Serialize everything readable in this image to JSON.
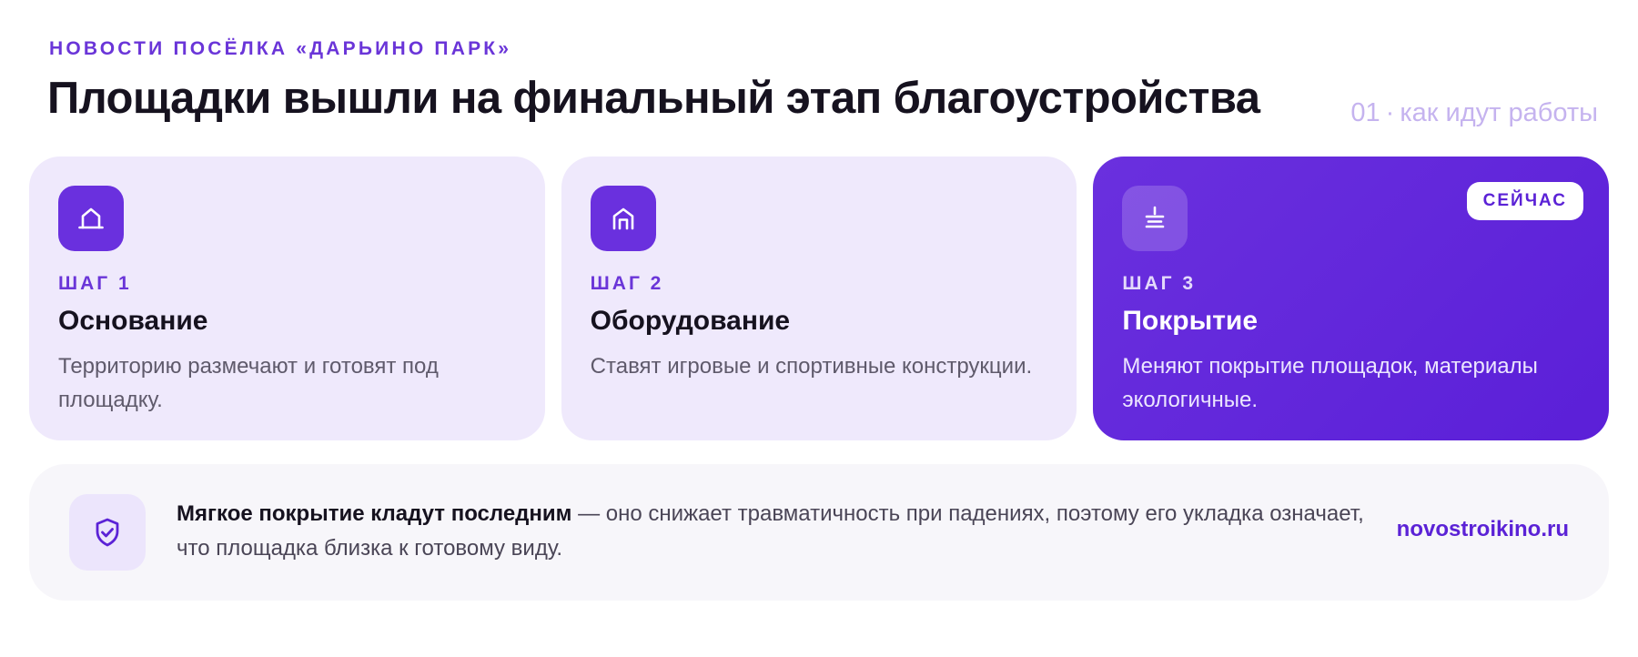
{
  "header": {
    "eyebrow": "НОВОСТИ ПОСЁЛКА «ДАРЬИНО ПАРК»",
    "title": "Площадки вышли на финальный этап благоустройства",
    "meta_number": "01",
    "meta_separator": "·",
    "meta_text": "как идут работы"
  },
  "steps": [
    {
      "icon": "house-outline-icon",
      "label": "ШАГ 1",
      "title": "Основание",
      "description": "Территорию размечают и готовят под площадку.",
      "active": false
    },
    {
      "icon": "arch-structure-icon",
      "label": "ШАГ 2",
      "title": "Оборудование",
      "description": "Ставят игровые и спортивные конструкции.",
      "active": false
    },
    {
      "icon": "layers-ground-icon",
      "label": "ШАГ 3",
      "title": "Покрытие",
      "description": "Меняют покрытие площадок, материалы экологичные.",
      "active": true,
      "badge": "СЕЙЧАС"
    }
  ],
  "note": {
    "icon": "shield-check-icon",
    "bold": "Мягкое покрытие кладут последним",
    "text": " — оно снижает травматичность при падениях, поэтому его укладка означает, что площадка близка к готовому виду.",
    "source": "novostroikino.ru"
  },
  "colors": {
    "accent": "#6a30de",
    "card_bg": "#efe9fc",
    "note_bg": "#f7f6fa",
    "meta_text": "#c5b3ef"
  }
}
